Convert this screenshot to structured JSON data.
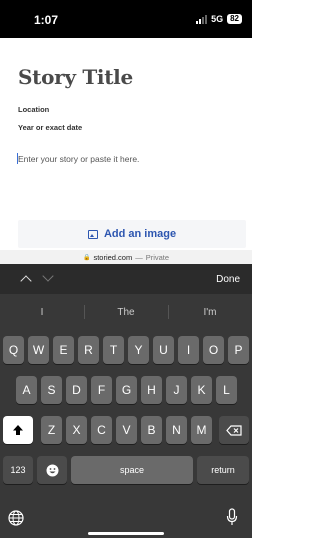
{
  "status_bar": {
    "time": "1:07",
    "network": "5G",
    "battery": "82"
  },
  "editor": {
    "title": "Story Title",
    "location": "Location",
    "date": "Year or exact date",
    "story_placeholder": "Enter your story or paste it here.",
    "add_image": "Add an image"
  },
  "url_bar": {
    "domain": "storied.com",
    "separator": "—",
    "privacy": "Private"
  },
  "accessory": {
    "done": "Done"
  },
  "suggestions": [
    "I",
    "The",
    "I'm"
  ],
  "keyboard": {
    "row1": [
      "Q",
      "W",
      "E",
      "R",
      "T",
      "Y",
      "U",
      "I",
      "O",
      "P"
    ],
    "row2": [
      "A",
      "S",
      "D",
      "F",
      "G",
      "H",
      "J",
      "K",
      "L"
    ],
    "row3": [
      "Z",
      "X",
      "C",
      "V",
      "B",
      "N",
      "M"
    ],
    "numbers": "123",
    "space": "space",
    "return": "return"
  }
}
